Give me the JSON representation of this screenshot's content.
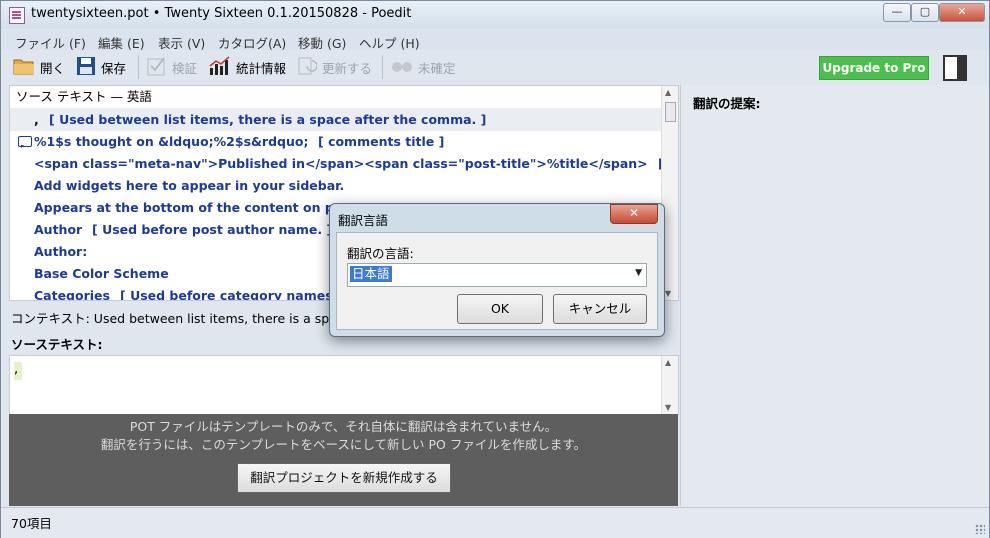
{
  "window": {
    "title": "twentysixteen.pot • Twenty Sixteen 0.1.20150828 - Poedit",
    "controls": {
      "minimize": "—",
      "maximize": "▢",
      "close": "✕"
    }
  },
  "menubar": {
    "items": [
      "ファイル (F)",
      "編集 (E)",
      "表示 (V)",
      "カタログ(A)",
      "移動 (G)",
      "ヘルプ (H)"
    ]
  },
  "toolbar": {
    "open": "開く",
    "save": "保存",
    "validate": "検証",
    "stats": "統計情報",
    "update": "更新する",
    "unconfirmed": "未確定",
    "upgrade": "Upgrade to Pro",
    "icons": {
      "open": "folder-icon",
      "save": "floppy-icon",
      "validate": "check-icon",
      "stats": "chart-icon",
      "update": "refresh-icon",
      "unconfirmed": "glasses-icon",
      "sidebar": "sidebar-toggle-icon"
    }
  },
  "list": {
    "header": "ソース テキスト — 英語",
    "rows": [
      {
        "text": ",",
        "context": "[ Used between list items, there is a space after the comma. ]",
        "selected": true,
        "comment": false
      },
      {
        "text": "%1$s thought on &ldquo;%2$s&rdquo;",
        "context": "[ comments title ]",
        "selected": false,
        "comment": true
      },
      {
        "text": "<span class=\"meta-nav\">Published in</span><span class=\"post-title\">%title</span>",
        "context": "[ Pa...",
        "selected": false,
        "comment": false
      },
      {
        "text": "Add widgets here to appear in your sidebar.",
        "context": "",
        "selected": false,
        "comment": false
      },
      {
        "text": "Appears at the bottom of the content on posts",
        "context": "",
        "selected": false,
        "comment": false
      },
      {
        "text": "Author",
        "context": "[ Used before post author name. ]",
        "selected": false,
        "comment": false
      },
      {
        "text": "Author:",
        "context": "",
        "selected": false,
        "comment": false
      },
      {
        "text": "Base Color Scheme",
        "context": "",
        "selected": false,
        "comment": false
      },
      {
        "text": "Categories",
        "context": "[ Used before category names. ]",
        "selected": false,
        "comment": false
      }
    ]
  },
  "context_line": "コンテキスト: Used between list items, there is a space",
  "source_label": "ソーステキスト:",
  "source_value": ",",
  "info": {
    "line1": "POT ファイルはテンプレートのみで、それ自体に翻訳は含まれていません。",
    "line2": "翻訳を行うには、このテンプレートをベースにして新しい PO ファイルを作成します。",
    "button": "翻訳プロジェクトを新規作成する"
  },
  "suggestions": {
    "title": "翻訳の提案:"
  },
  "status": {
    "count": "70項目"
  },
  "dialog": {
    "title": "翻訳言語",
    "close": "✕",
    "label": "翻訳の言語:",
    "selected": "日本語",
    "ok": "OK",
    "cancel": "キャンセル"
  },
  "colors": {
    "upgrade": "#4cc04c",
    "source_text": "#1a3a9c",
    "info_bg": "#5e5e5e"
  }
}
